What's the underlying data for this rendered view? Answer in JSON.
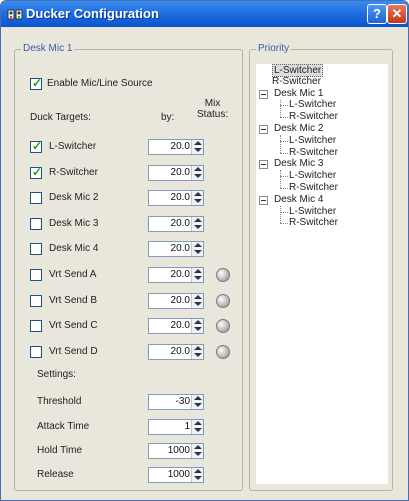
{
  "window": {
    "title": "Ducker Configuration",
    "help_label": "?",
    "close_label": "✕"
  },
  "left_group": {
    "title": "Desk Mic 1",
    "enable": {
      "label": "Enable Mic/Line Source",
      "checked": true
    },
    "headers": {
      "targets": "Duck Targets:",
      "by": "by:",
      "mix_status": "Mix\nStatus:"
    },
    "targets": [
      {
        "label": "L-Switcher",
        "checked": true,
        "value": "20.0",
        "led": false
      },
      {
        "label": "R-Switcher",
        "checked": true,
        "value": "20.0",
        "led": false
      },
      {
        "label": "Desk Mic 2",
        "checked": false,
        "value": "20.0",
        "led": false
      },
      {
        "label": "Desk Mic 3",
        "checked": false,
        "value": "20.0",
        "led": false
      },
      {
        "label": "Desk Mic 4",
        "checked": false,
        "value": "20.0",
        "led": false
      },
      {
        "label": "Vrt Send A",
        "checked": false,
        "value": "20.0",
        "led": true
      },
      {
        "label": "Vrt Send B",
        "checked": false,
        "value": "20.0",
        "led": true
      },
      {
        "label": "Vrt Send C",
        "checked": false,
        "value": "20.0",
        "led": true
      },
      {
        "label": "Vrt Send D",
        "checked": false,
        "value": "20.0",
        "led": true
      }
    ],
    "settings_label": "Settings:",
    "settings": [
      {
        "label": "Threshold",
        "value": "-30"
      },
      {
        "label": "Attack Time",
        "value": "1"
      },
      {
        "label": "Hold Time",
        "value": "1000"
      },
      {
        "label": "Release",
        "value": "1000"
      }
    ]
  },
  "priority": {
    "title": "Priority",
    "nodes": [
      {
        "label": "L-Switcher",
        "level": 0,
        "selected": true,
        "expander": false
      },
      {
        "label": "R-Switcher",
        "level": 0,
        "selected": false,
        "expander": false
      },
      {
        "label": "Desk Mic 1",
        "level": 0,
        "selected": false,
        "expander": true
      },
      {
        "label": "L-Switcher",
        "level": 1,
        "selected": false,
        "expander": false
      },
      {
        "label": "R-Switcher",
        "level": 1,
        "selected": false,
        "expander": false
      },
      {
        "label": "Desk Mic 2",
        "level": 0,
        "selected": false,
        "expander": true
      },
      {
        "label": "L-Switcher",
        "level": 1,
        "selected": false,
        "expander": false
      },
      {
        "label": "R-Switcher",
        "level": 1,
        "selected": false,
        "expander": false
      },
      {
        "label": "Desk Mic 3",
        "level": 0,
        "selected": false,
        "expander": true
      },
      {
        "label": "L-Switcher",
        "level": 1,
        "selected": false,
        "expander": false
      },
      {
        "label": "R-Switcher",
        "level": 1,
        "selected": false,
        "expander": false
      },
      {
        "label": "Desk Mic 4",
        "level": 0,
        "selected": false,
        "expander": true
      },
      {
        "label": "L-Switcher",
        "level": 1,
        "selected": false,
        "expander": false
      },
      {
        "label": "R-Switcher",
        "level": 1,
        "selected": false,
        "expander": false
      }
    ]
  }
}
